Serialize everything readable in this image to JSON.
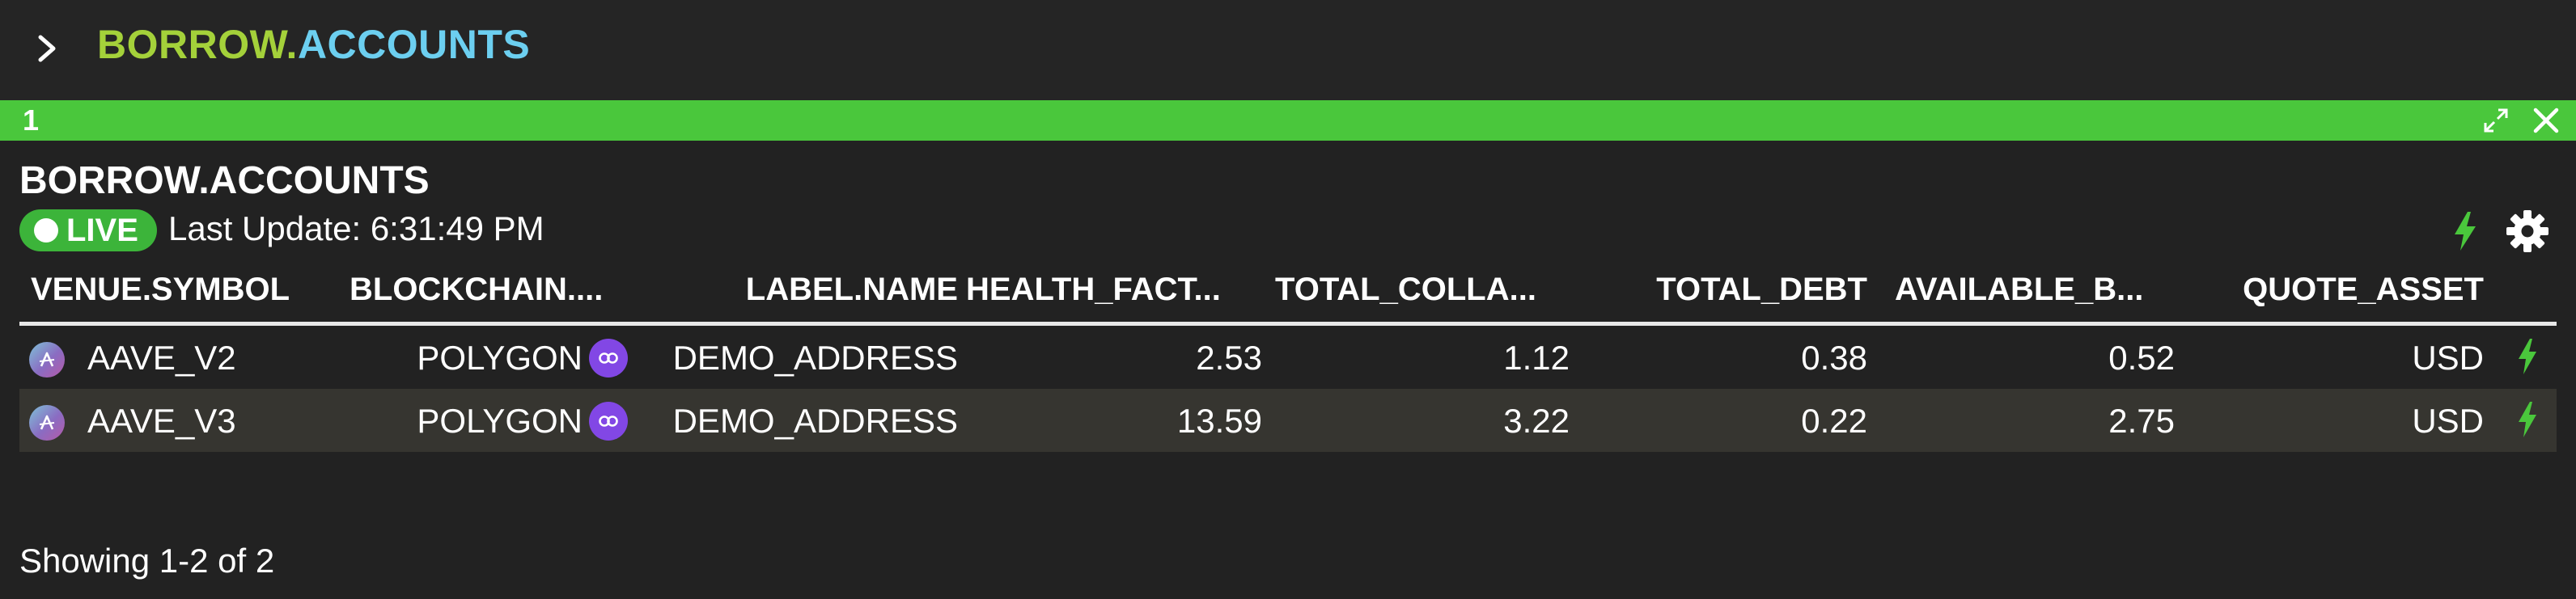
{
  "command_bar": {
    "title_part1": "BORROW",
    "title_dot": ".",
    "title_part2": "ACCOUNTS",
    "chevron_icon": "chevron-right-icon"
  },
  "panel": {
    "number": "1",
    "header_color": "#4ac73c",
    "icons": [
      "expand-icon",
      "close-icon"
    ]
  },
  "widget": {
    "title": "BORROW.ACCOUNTS",
    "live_label": "LIVE",
    "last_update": "Last Update: 6:31:49 PM",
    "icons": [
      "bolt-icon",
      "gear-icon"
    ]
  },
  "table": {
    "columns": [
      "VENUE.SYMBOL",
      "BLOCKCHAIN....",
      "LABEL.NAME",
      "HEALTH_FACT...",
      "TOTAL_COLLA...",
      "TOTAL_DEBT",
      "AVAILABLE_B...",
      "QUOTE_ASSET"
    ],
    "rows": [
      {
        "venue": "AAVE_V2",
        "blockchain": "POLYGON",
        "label": "DEMO_ADDRESS",
        "health_factor": "2.53",
        "total_collateral": "1.12",
        "total_debt": "0.38",
        "available_borrow": "0.52",
        "quote_asset": "USD"
      },
      {
        "venue": "AAVE_V3",
        "blockchain": "POLYGON",
        "label": "DEMO_ADDRESS",
        "health_factor": "13.59",
        "total_collateral": "3.22",
        "total_debt": "0.22",
        "available_borrow": "2.75",
        "quote_asset": "USD"
      }
    ]
  },
  "footer": {
    "showing": "Showing 1-2 of 2"
  },
  "colors": {
    "background": "#222222",
    "live_green": "#3cb43a",
    "accent_lime": "#a4d13a",
    "accent_cyan": "#6ccff0",
    "polygon_purple": "#8247e5"
  }
}
